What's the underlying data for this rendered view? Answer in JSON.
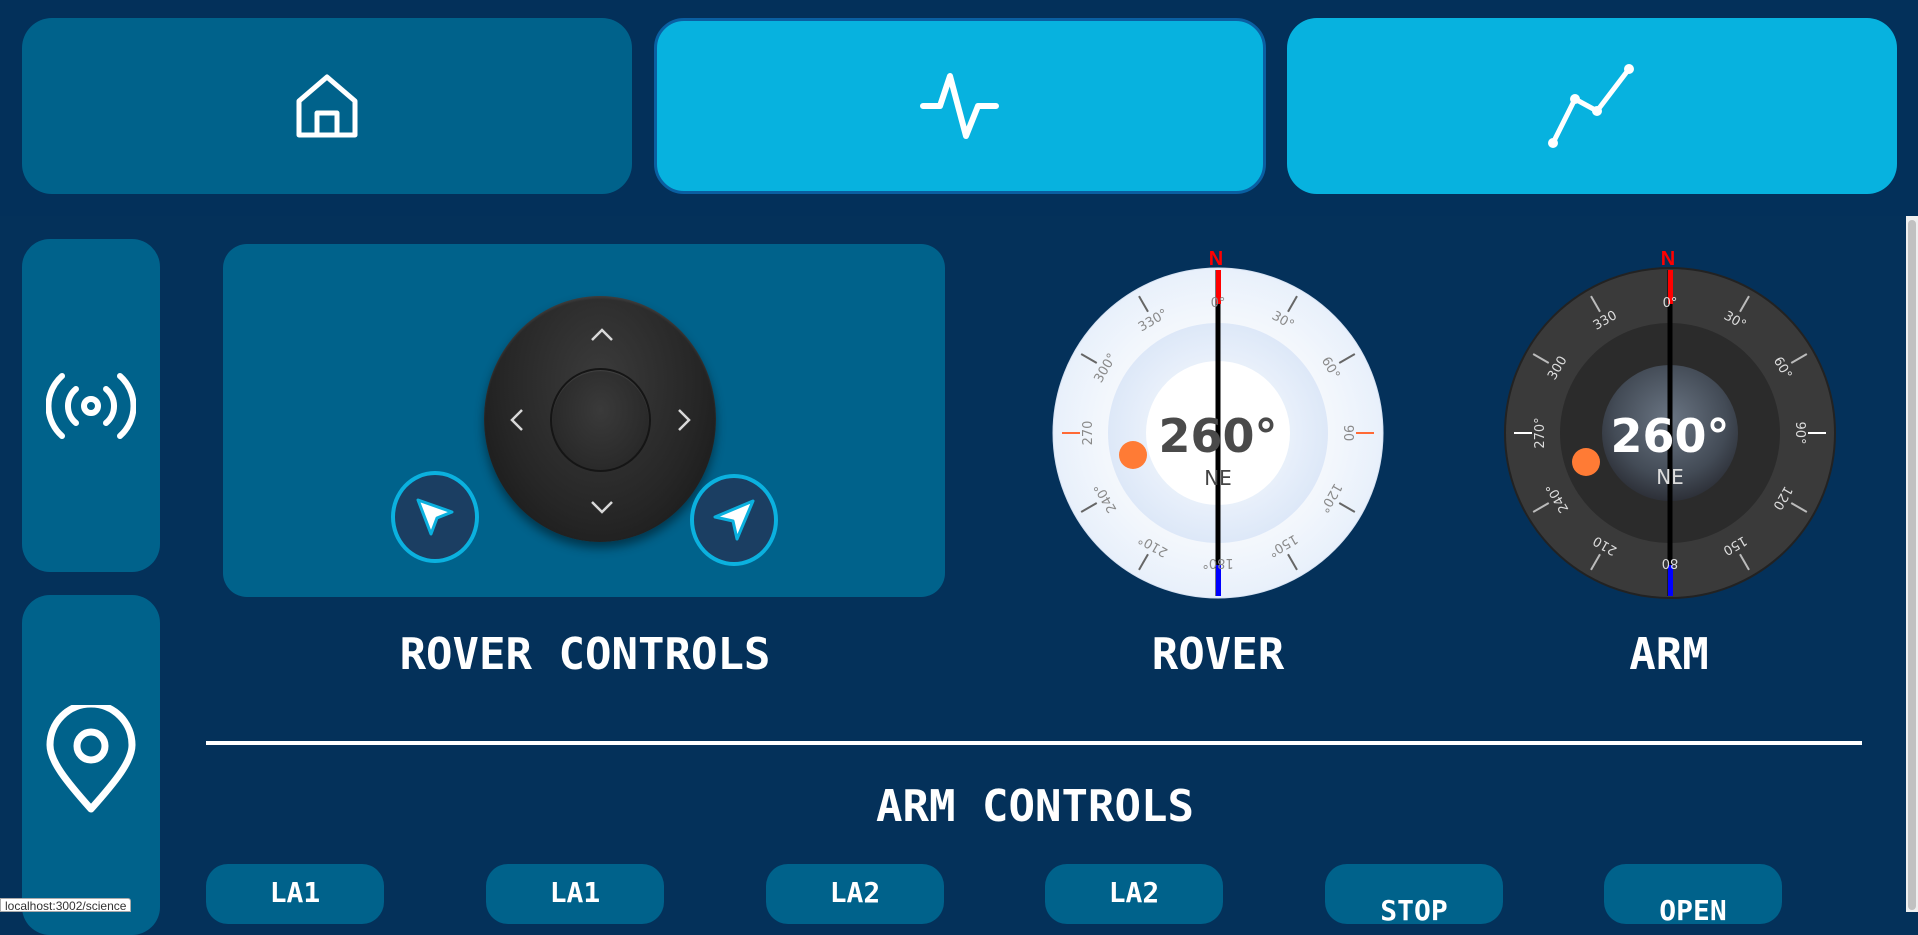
{
  "nav": {
    "home_icon": "home-icon",
    "science_icon": "activity-icon",
    "graph_icon": "line-graph-icon"
  },
  "sidebar": {
    "items": [
      {
        "icon": "broadcast-icon"
      },
      {
        "icon": "map-pin-icon"
      }
    ]
  },
  "rover_controls": {
    "title": "ROVER CONTROLS",
    "left_button_icon": "cursor-arrow-icon",
    "right_button_icon": "navigation-arrow-icon"
  },
  "compasses": [
    {
      "id": "rover",
      "label": "ROVER",
      "heading": "260°",
      "direction": "NE",
      "north_marker": "N",
      "ticks": [
        "0°",
        "30°",
        "60°",
        "90",
        "120°",
        "150°",
        "180°",
        "210°",
        "240°",
        "270",
        "300°",
        "330°"
      ],
      "theme": "light"
    },
    {
      "id": "arm",
      "label": "ARM",
      "heading": "260°",
      "direction": "NE",
      "north_marker": "N",
      "ticks": [
        "0°",
        "30°",
        "60°",
        "90°",
        "120",
        "150",
        "80",
        "210",
        "240°",
        "270°",
        "300",
        "330"
      ],
      "theme": "dark"
    }
  ],
  "arm_controls": {
    "title": "ARM CONTROLS",
    "buttons": [
      "LA1",
      "LA1",
      "LA2",
      "LA2",
      "STOP",
      "OPEN"
    ]
  },
  "status_url": "localhost:3002/science",
  "colors": {
    "background": "#04315a",
    "panel": "#00628b",
    "accent": "#07b2df",
    "north": "#ff0000",
    "south": "#0000ff",
    "marker": "#ff7b35"
  }
}
